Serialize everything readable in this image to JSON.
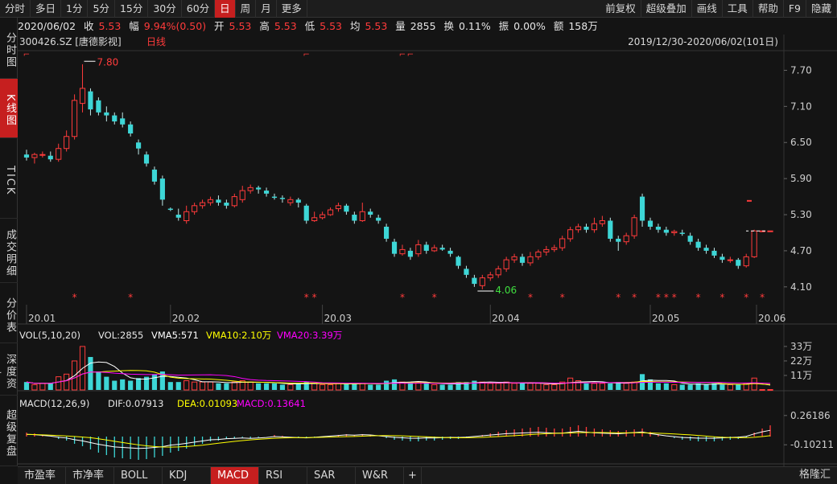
{
  "toolbar": {
    "periods": [
      "分时",
      "多日",
      "1分",
      "5分",
      "15分",
      "30分",
      "60分",
      "日",
      "周",
      "月",
      "更多"
    ],
    "active_period": "日",
    "right_items": [
      "前复权",
      "超级叠加",
      "画线",
      "工具",
      "帮助",
      "F9",
      "隐藏"
    ]
  },
  "info": {
    "date": "2020/06/02",
    "close_label": "收",
    "close": "5.53",
    "change_label": "幅",
    "change": "9.94%(0.50)",
    "open_label": "开",
    "open": "5.53",
    "high_label": "高",
    "high": "5.53",
    "low_label": "低",
    "low": "5.53",
    "avg_label": "均",
    "avg": "5.53",
    "volume_label": "量",
    "volume": "2855",
    "turnover_label": "换",
    "turnover": "0.11%",
    "amplitude_label": "振",
    "amplitude": "0.00%",
    "amount_label": "额",
    "amount": "158万"
  },
  "stock": {
    "code": "300426.SZ",
    "name": "[唐德影视]",
    "period": "日线",
    "range": "2019/12/30-2020/06/02(101日)"
  },
  "left_tabs": [
    "分时图",
    "K线图",
    "TICK",
    "成交明细",
    "分价表",
    "深度资料",
    "超级复盘"
  ],
  "active_left_tab": "K线图",
  "vol_label": "VOL(5,10,20)",
  "vol_value": "VOL:2855",
  "vma5": "VMA5:571",
  "vma10": "VMA10:2.10万",
  "vma20": "VMA20:3.39万",
  "macd_label": "MACD(12,26,9)",
  "dif": "DIF:0.07913",
  "dea": "DEA:0.01093",
  "macd": "MACD:0.13641",
  "bottom_tabs": [
    "市盈率",
    "市净率",
    "BOLL",
    "KDJ",
    "MACD",
    "RSI",
    "SAR",
    "W&R",
    "+"
  ],
  "active_bottom_tab": "MACD",
  "logo": "格隆汇",
  "colors": {
    "up": "#ff3b3b",
    "down": "#3dd6d6",
    "active_tab": "#c61f1f",
    "vma5": "#ffffff",
    "vma10": "#ffff00",
    "vma20": "#ff00ff"
  },
  "chart_data": [
    {
      "type": "candlestick",
      "title": "300426.SZ [唐德影视] 日线",
      "date_range": "2019/12/30-2020/06/02",
      "x_ticks": [
        "20.01",
        "20.02",
        "20.03",
        "20.04",
        "20.05",
        "20.06"
      ],
      "y_ticks": [
        7.7,
        7.1,
        6.5,
        5.9,
        5.3,
        4.7,
        4.1
      ],
      "ylim": [
        3.75,
        8.0
      ],
      "annotations": [
        {
          "label": "7.80",
          "value": 7.8,
          "kind": "high"
        },
        {
          "label": "4.06",
          "value": 4.06,
          "kind": "low"
        }
      ],
      "candles": [
        [
          6.3,
          6.25,
          6.38,
          6.2
        ],
        [
          6.25,
          6.3,
          6.33,
          6.15
        ],
        [
          6.3,
          6.3,
          6.35,
          6.25
        ],
        [
          6.28,
          6.22,
          6.35,
          6.18
        ],
        [
          6.22,
          6.4,
          6.48,
          6.18
        ],
        [
          6.4,
          6.6,
          6.7,
          6.35
        ],
        [
          6.6,
          7.2,
          7.3,
          6.55
        ],
        [
          7.15,
          7.4,
          7.8,
          7.0
        ],
        [
          7.35,
          7.05,
          7.4,
          6.95
        ],
        [
          7.2,
          7.0,
          7.25,
          6.95
        ],
        [
          7.0,
          6.95,
          7.1,
          6.85
        ],
        [
          6.95,
          6.85,
          7.0,
          6.8
        ],
        [
          6.9,
          6.8,
          7.0,
          6.75
        ],
        [
          6.8,
          6.65,
          6.85,
          6.6
        ],
        [
          6.5,
          6.4,
          6.55,
          6.3
        ],
        [
          6.3,
          6.15,
          6.35,
          6.1
        ],
        [
          6.05,
          5.85,
          6.1,
          5.8
        ],
        [
          5.9,
          5.55,
          5.95,
          5.45
        ],
        [
          5.4,
          5.38,
          5.42,
          5.36
        ],
        [
          5.3,
          5.25,
          5.4,
          5.2
        ],
        [
          5.2,
          5.35,
          5.45,
          5.15
        ],
        [
          5.35,
          5.45,
          5.5,
          5.3
        ],
        [
          5.45,
          5.5,
          5.55,
          5.4
        ],
        [
          5.5,
          5.55,
          5.6,
          5.45
        ],
        [
          5.55,
          5.5,
          5.62,
          5.45
        ],
        [
          5.5,
          5.45,
          5.55,
          5.4
        ],
        [
          5.45,
          5.6,
          5.65,
          5.42
        ],
        [
          5.55,
          5.7,
          5.78,
          5.5
        ],
        [
          5.7,
          5.75,
          5.8,
          5.65
        ],
        [
          5.75,
          5.72,
          5.78,
          5.65
        ],
        [
          5.7,
          5.65,
          5.75,
          5.6
        ],
        [
          5.6,
          5.58,
          5.65,
          5.55
        ],
        [
          5.58,
          5.56,
          5.62,
          5.5
        ],
        [
          5.5,
          5.55,
          5.6,
          5.45
        ],
        [
          5.55,
          5.5,
          5.58,
          5.42
        ],
        [
          5.45,
          5.2,
          5.48,
          5.15
        ],
        [
          5.2,
          5.25,
          5.35,
          5.18
        ],
        [
          5.25,
          5.3,
          5.35,
          5.22
        ],
        [
          5.3,
          5.38,
          5.42,
          5.28
        ],
        [
          5.4,
          5.45,
          5.5,
          5.35
        ],
        [
          5.45,
          5.35,
          5.48,
          5.3
        ],
        [
          5.3,
          5.2,
          5.35,
          5.15
        ],
        [
          5.2,
          5.35,
          5.5,
          5.18
        ],
        [
          5.35,
          5.3,
          5.4,
          5.25
        ],
        [
          5.25,
          5.2,
          5.3,
          5.15
        ],
        [
          5.1,
          4.9,
          5.15,
          4.85
        ],
        [
          4.85,
          4.65,
          4.9,
          4.6
        ],
        [
          4.65,
          4.72,
          4.8,
          4.62
        ],
        [
          4.7,
          4.6,
          4.75,
          4.55
        ],
        [
          4.65,
          4.8,
          4.88,
          4.6
        ],
        [
          4.8,
          4.7,
          4.85,
          4.65
        ],
        [
          4.7,
          4.75,
          4.8,
          4.68
        ],
        [
          4.75,
          4.72,
          4.8,
          4.7
        ],
        [
          4.7,
          4.65,
          4.75,
          4.6
        ],
        [
          4.6,
          4.45,
          4.62,
          4.4
        ],
        [
          4.4,
          4.3,
          4.45,
          4.25
        ],
        [
          4.25,
          4.15,
          4.3,
          4.1
        ],
        [
          4.12,
          4.25,
          4.3,
          4.06
        ],
        [
          4.25,
          4.3,
          4.35,
          4.2
        ],
        [
          4.3,
          4.4,
          4.45,
          4.25
        ],
        [
          4.4,
          4.55,
          4.6,
          4.35
        ],
        [
          4.55,
          4.6,
          4.65,
          4.5
        ],
        [
          4.6,
          4.5,
          4.65,
          4.45
        ],
        [
          4.5,
          4.6,
          4.68,
          4.45
        ],
        [
          4.6,
          4.68,
          4.72,
          4.55
        ],
        [
          4.68,
          4.72,
          4.78,
          4.62
        ],
        [
          4.72,
          4.75,
          4.8,
          4.68
        ],
        [
          4.75,
          4.9,
          4.95,
          4.7
        ],
        [
          4.9,
          5.05,
          5.1,
          4.85
        ],
        [
          5.05,
          5.1,
          5.15,
          5.0
        ],
        [
          5.1,
          5.05,
          5.15,
          5.0
        ],
        [
          5.05,
          5.15,
          5.25,
          5.0
        ],
        [
          5.15,
          5.2,
          5.28,
          5.1
        ],
        [
          5.2,
          4.9,
          5.25,
          4.85
        ],
        [
          4.9,
          4.85,
          4.95,
          4.7
        ],
        [
          4.85,
          4.95,
          5.0,
          4.8
        ],
        [
          4.95,
          5.25,
          5.3,
          4.9
        ],
        [
          5.6,
          5.2,
          5.65,
          5.1
        ],
        [
          5.2,
          5.1,
          5.25,
          5.05
        ],
        [
          5.1,
          5.05,
          5.15,
          5.0
        ],
        [
          5.05,
          5.0,
          5.1,
          4.95
        ],
        [
          5.0,
          5.02,
          5.05,
          4.95
        ],
        [
          5.0,
          4.98,
          5.05,
          4.95
        ],
        [
          4.95,
          4.85,
          5.0,
          4.8
        ],
        [
          4.85,
          4.75,
          4.9,
          4.7
        ],
        [
          4.75,
          4.7,
          4.8,
          4.65
        ],
        [
          4.7,
          4.62,
          4.75,
          4.58
        ],
        [
          4.6,
          4.55,
          4.65,
          4.5
        ],
        [
          4.55,
          4.55,
          4.6,
          4.5
        ],
        [
          4.55,
          4.45,
          4.58,
          4.4
        ],
        [
          4.45,
          4.6,
          4.65,
          4.42
        ],
        [
          4.6,
          5.03,
          5.05,
          4.58
        ],
        [
          5.03,
          5.03,
          5.03,
          5.03
        ],
        [
          5.03,
          5.03,
          5.03,
          5.03
        ]
      ],
      "volumes": [
        6,
        4,
        5,
        5,
        10,
        12,
        22,
        33,
        25,
        14,
        10,
        7,
        8,
        7,
        9,
        10,
        12,
        14,
        6,
        6,
        7,
        6,
        6,
        6,
        5,
        5,
        6,
        7,
        6,
        5,
        5,
        5,
        4,
        4,
        5,
        6,
        5,
        4,
        4,
        5,
        5,
        5,
        5,
        4,
        4,
        7,
        8,
        6,
        5,
        6,
        5,
        4,
        4,
        4,
        6,
        6,
        7,
        6,
        5,
        5,
        6,
        5,
        5,
        5,
        5,
        4,
        4,
        6,
        9,
        7,
        5,
        5,
        5,
        5,
        6,
        5,
        6,
        12,
        8,
        5,
        5,
        4,
        4,
        4,
        5,
        4,
        5,
        4,
        4,
        4,
        5,
        9,
        0.3,
        0.3
      ],
      "macd": [
        0.05,
        0.04,
        0.02,
        0.0,
        -0.03,
        -0.05,
        -0.09,
        -0.12,
        -0.16,
        -0.2,
        -0.23,
        -0.26,
        -0.27,
        -0.28,
        -0.29,
        -0.28,
        -0.26,
        -0.24,
        -0.2,
        -0.18,
        -0.15,
        -0.12,
        -0.09,
        -0.06,
        -0.05,
        -0.03,
        -0.02,
        -0.01,
        -0.02,
        -0.01,
        0.0,
        0.02,
        0.01,
        0.0,
        -0.01,
        -0.02,
        -0.01,
        0.0,
        0.01,
        0.02,
        0.03,
        0.02,
        0.03,
        0.02,
        0.0,
        -0.02,
        -0.04,
        -0.05,
        -0.06,
        -0.06,
        -0.05,
        -0.05,
        -0.04,
        -0.03,
        -0.03,
        -0.02,
        0.0,
        0.02,
        0.04,
        0.06,
        0.08,
        0.09,
        0.1,
        0.11,
        0.12,
        0.11,
        0.1,
        0.1,
        0.12,
        0.14,
        0.12,
        0.1,
        0.09,
        0.08,
        0.07,
        0.08,
        0.09,
        0.1,
        0.06,
        0.03,
        0.0,
        -0.02,
        -0.04,
        -0.05,
        -0.06,
        -0.06,
        -0.06,
        -0.05,
        -0.04,
        -0.03,
        -0.01,
        0.05,
        0.1,
        0.14
      ]
    }
  ]
}
